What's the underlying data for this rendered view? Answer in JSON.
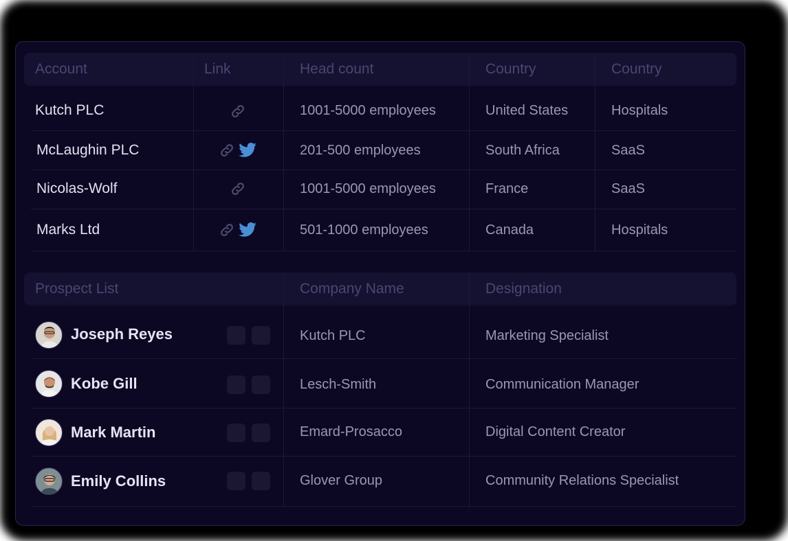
{
  "accounts_table": {
    "headers": [
      "Account",
      "Link",
      "Head count",
      "Country",
      "Country"
    ],
    "rows": [
      {
        "account": "Kutch PLC",
        "links": [
          "link-icon"
        ],
        "head_count": "1001-5000 employees",
        "country": "United States",
        "industry": "Hospitals"
      },
      {
        "account": "McLaughin PLC",
        "links": [
          "link-icon",
          "twitter-icon"
        ],
        "head_count": "201-500 employees",
        "country": "South Africa",
        "industry": "SaaS"
      },
      {
        "account": "Nicolas-Wolf",
        "links": [
          "link-icon"
        ],
        "head_count": "1001-5000 employees",
        "country": "France",
        "industry": "SaaS"
      },
      {
        "account": "Marks Ltd",
        "links": [
          "link-icon",
          "twitter-icon"
        ],
        "head_count": "501-1000 employees",
        "country": "Canada",
        "industry": "Hospitals"
      }
    ]
  },
  "prospects_table": {
    "headers": [
      "Prospect List",
      "Company Name",
      "Designation"
    ],
    "rows": [
      {
        "name": "Joseph Reyes",
        "company": "Kutch PLC",
        "designation": "Marketing Specialist"
      },
      {
        "name": "Kobe Gill",
        "company": "Lesch-Smith",
        "designation": "Communication Manager"
      },
      {
        "name": "Mark Martin",
        "company": "Emard-Prosacco",
        "designation": "Digital Content Creator"
      },
      {
        "name": "Emily Collins",
        "company": "Glover Group",
        "designation": "Community Relations Specialist"
      }
    ]
  },
  "colors": {
    "panel_bg": "#0c0823",
    "header_bg": "#151131",
    "link_icon": "#4e4a6e",
    "twitter_icon": "#4a8fd6"
  }
}
